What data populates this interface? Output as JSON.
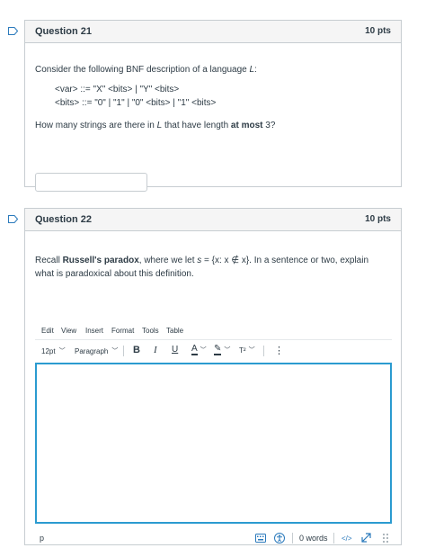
{
  "q21": {
    "title": "Question 21",
    "pts": "10 pts",
    "intro_pre": "Consider the following BNF description of a language ",
    "intro_var": "L",
    "intro_post": ":",
    "bnf_line1": "<var> ::= \"X\" <bits> | \"Y\" <bits>",
    "bnf_line2": "<bits> ::= \"0\" | \"1\" | \"0\" <bits> | \"1\" <bits>",
    "ask_pre": "How many strings are there in ",
    "ask_var": "L",
    "ask_mid": " that have length ",
    "ask_bold": "at most",
    "ask_post": " 3?",
    "answer_value": ""
  },
  "q22": {
    "title": "Question 22",
    "pts": "10 pts",
    "p1_pre": "Recall ",
    "p1_bold": "Russell's paradox",
    "p1_mid": ", where we let ",
    "p1_math": "s",
    "p1_set": " = {x:  x ∉ x}",
    "p1_post": ".  In a sentence or two, explain",
    "p2": "what is paradoxical about this definition."
  },
  "editor": {
    "menu": [
      "Edit",
      "View",
      "Insert",
      "Format",
      "Tools",
      "Table"
    ],
    "font_size": "12pt",
    "block_format": "Paragraph",
    "bold": "B",
    "italic": "I",
    "underline": "U",
    "text_color": "A",
    "superscript": "T²",
    "more": "⋮",
    "path": "p",
    "word_count": "0 words",
    "html_toggle": "</>"
  },
  "colors": {
    "focus": "#2b9bd0",
    "link": "#2b7abc",
    "text": "#2d3b45",
    "border": "#c7cdd1"
  }
}
